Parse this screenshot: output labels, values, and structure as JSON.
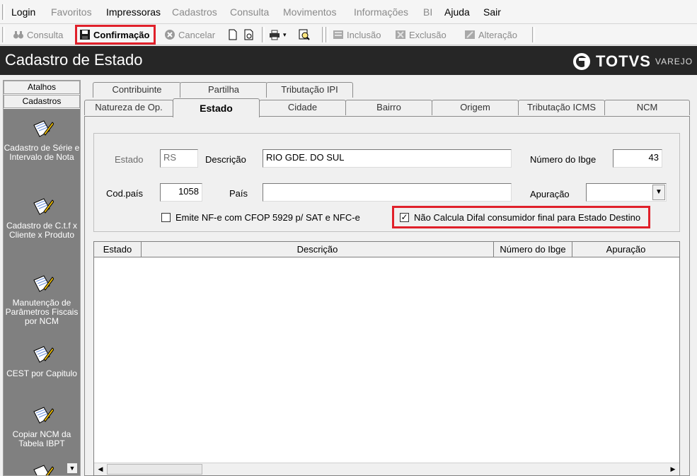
{
  "menu": {
    "items": [
      {
        "label": "Login",
        "enabled": true
      },
      {
        "label": "Favoritos",
        "enabled": false
      },
      {
        "label": "Impressoras",
        "enabled": true
      },
      {
        "label": "Cadastros",
        "enabled": false
      },
      {
        "label": "Consulta",
        "enabled": false
      },
      {
        "label": "Movimentos",
        "enabled": false
      },
      {
        "label": "Informações",
        "enabled": false
      },
      {
        "label": "BI",
        "enabled": false
      },
      {
        "label": "Ajuda",
        "enabled": true
      },
      {
        "label": "Sair",
        "enabled": true
      }
    ]
  },
  "toolbar": {
    "consulta": "Consulta",
    "confirmacao": "Confirmação",
    "cancelar": "Cancelar",
    "inclusao": "Inclusão",
    "exclusao": "Exclusão",
    "alteracao": "Alteração",
    "highlight_color": "#e0202a"
  },
  "window": {
    "title": "Cadastro de Estado",
    "logo_brand": "TOTVS",
    "logo_sub": "VAREJO"
  },
  "sidebar": {
    "atalhos": "Atalhos",
    "cadastros": "Cadastros",
    "shortcuts": [
      {
        "label": "Cadastro de Série e Intervalo de Nota"
      },
      {
        "label": "Cadastro de C.t.f x Cliente x Produto"
      },
      {
        "label": "Manutenção de Parâmetros Fiscais por NCM"
      },
      {
        "label": "CEST por Capitulo"
      },
      {
        "label": "Copiar NCM da Tabela IBPT"
      }
    ]
  },
  "tabs": {
    "row1": [
      "Contribuinte",
      "Partilha",
      "Tributação IPI"
    ],
    "row2": [
      "Natureza de Op.",
      "Estado",
      "Cidade",
      "Bairro",
      "Origem",
      "Tributação ICMS",
      "NCM"
    ],
    "active": "Estado"
  },
  "form": {
    "estado_label": "Estado",
    "estado_value": "RS",
    "descricao_label": "Descrição",
    "descricao_value": "RIO GDE. DO SUL",
    "numero_ibge_label": "Número do Ibge",
    "numero_ibge_value": "43",
    "cod_pais_label": "Cod.país",
    "cod_pais_value": "1058",
    "pais_label": "País",
    "pais_value": "",
    "apuracao_label": "Apuração",
    "apuracao_value": "",
    "emite_nfe_label": "Emite NF-e com CFOP 5929 p/ SAT e NFC-e",
    "emite_nfe_checked": false,
    "difal_label": "Não Calcula Difal consumidor final para Estado Destino",
    "difal_checked": true
  },
  "grid": {
    "columns": [
      "Estado",
      "Descrição",
      "Número do Ibge",
      "Apuração"
    ],
    "rows": []
  }
}
